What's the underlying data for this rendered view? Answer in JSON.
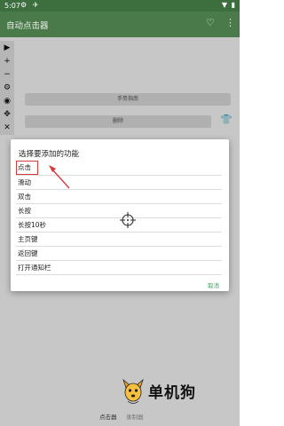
{
  "status_bar": {
    "time": "5:07",
    "icons_left": "⚙ ✈",
    "icons_right": "▼ ▮"
  },
  "app_bar": {
    "title": "自动点击器",
    "heart_icon": "♡",
    "more_icon": "⋮"
  },
  "float_toolbar": {
    "items": [
      "▶",
      "+",
      "−",
      "⚙",
      "◉",
      "✥",
      "✕"
    ]
  },
  "main": {
    "gesture_label": "手势指南",
    "delete_label": "删除",
    "shirt_icon": "👕"
  },
  "dialog": {
    "title": "选择要添加的功能",
    "options": [
      "点击",
      "滑动",
      "双击",
      "长按",
      "长按10秒",
      "主页键",
      "返回键",
      "打开通知栏"
    ],
    "cancel_label": "取消"
  },
  "watermark": {
    "text": "单机狗"
  },
  "bottom_nav": {
    "tab1": "点击器",
    "tab2": "录制器"
  },
  "colors": {
    "app_bar": "#4a7a4a",
    "accent": "#3fa35f",
    "highlight": "#d63b3b"
  }
}
